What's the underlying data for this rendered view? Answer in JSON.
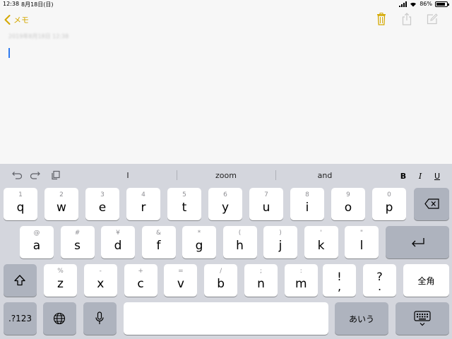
{
  "status_bar": {
    "time": "12:38",
    "date": "8月18日(日)",
    "battery": "86%",
    "battery_level": 0.86
  },
  "nav": {
    "back_label": "メモ"
  },
  "note": {
    "timestamp": "2019年8月18日 12:38"
  },
  "keyboard": {
    "suggestions": [
      "I",
      "zoom",
      "and"
    ],
    "format": {
      "bold": "B",
      "italic": "I",
      "underline": "U"
    },
    "row1": [
      {
        "sec": "1",
        "pri": "q"
      },
      {
        "sec": "2",
        "pri": "w"
      },
      {
        "sec": "3",
        "pri": "e"
      },
      {
        "sec": "4",
        "pri": "r"
      },
      {
        "sec": "5",
        "pri": "t"
      },
      {
        "sec": "6",
        "pri": "y"
      },
      {
        "sec": "7",
        "pri": "u"
      },
      {
        "sec": "8",
        "pri": "i"
      },
      {
        "sec": "9",
        "pri": "o"
      },
      {
        "sec": "0",
        "pri": "p"
      }
    ],
    "row2": [
      {
        "sec": "@",
        "pri": "a"
      },
      {
        "sec": "#",
        "pri": "s"
      },
      {
        "sec": "¥",
        "pri": "d"
      },
      {
        "sec": "&",
        "pri": "f"
      },
      {
        "sec": "*",
        "pri": "g"
      },
      {
        "sec": "(",
        "pri": "h"
      },
      {
        "sec": ")",
        "pri": "j"
      },
      {
        "sec": "'",
        "pri": "k"
      },
      {
        "sec": "\"",
        "pri": "l"
      }
    ],
    "row3": [
      {
        "sec": "%",
        "pri": "z"
      },
      {
        "sec": "-",
        "pri": "x"
      },
      {
        "sec": "+",
        "pri": "c"
      },
      {
        "sec": "=",
        "pri": "v"
      },
      {
        "sec": "/",
        "pri": "b"
      },
      {
        "sec": ";",
        "pri": "n"
      },
      {
        "sec": ":",
        "pri": "m"
      }
    ],
    "punct": [
      {
        "up": "!",
        "low": ","
      },
      {
        "up": "?",
        "low": "."
      }
    ],
    "zenkaku": "全角",
    "numbers": ".?123",
    "hiragana": "あいう"
  }
}
